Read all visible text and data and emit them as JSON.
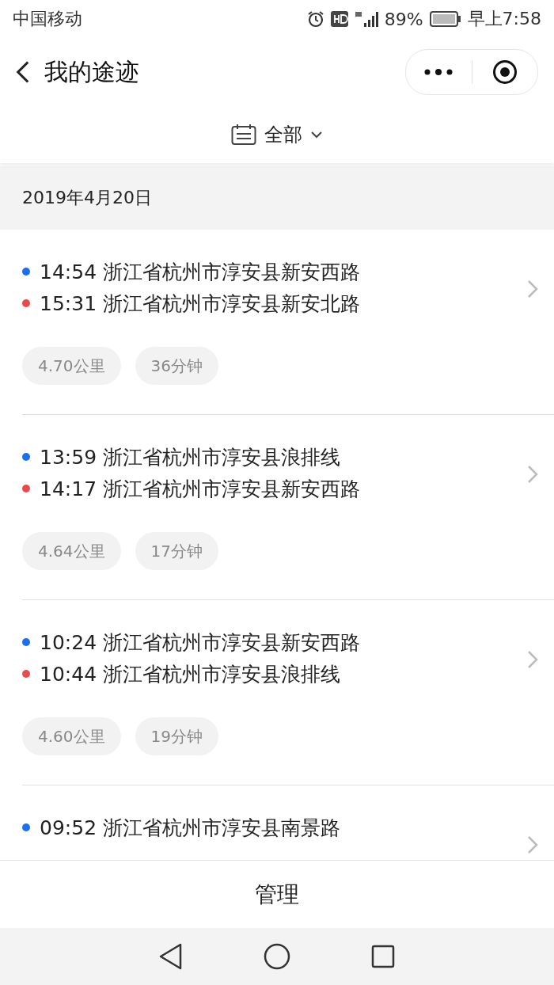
{
  "status_bar": {
    "carrier": "中国移动",
    "battery": "89%",
    "time": "早上7:58"
  },
  "header": {
    "title": "我的途迹"
  },
  "filter": {
    "label": "全部"
  },
  "date": "2019年4月20日",
  "trips": [
    {
      "start": {
        "time": "14:54",
        "place": "浙江省杭州市淳安县新安西路"
      },
      "end": {
        "time": "15:31",
        "place": "浙江省杭州市淳安县新安北路"
      },
      "distance": "4.70公里",
      "duration": "36分钟"
    },
    {
      "start": {
        "time": "13:59",
        "place": "浙江省杭州市淳安县浪排线"
      },
      "end": {
        "time": "14:17",
        "place": "浙江省杭州市淳安县新安西路"
      },
      "distance": "4.64公里",
      "duration": "17分钟"
    },
    {
      "start": {
        "time": "10:24",
        "place": "浙江省杭州市淳安县新安西路"
      },
      "end": {
        "time": "10:44",
        "place": "浙江省杭州市淳安县浪排线"
      },
      "distance": "4.60公里",
      "duration": "19分钟"
    },
    {
      "start": {
        "time": "09:52",
        "place": "浙江省杭州市淳安县南景路"
      }
    }
  ],
  "bottom_button": "管理"
}
